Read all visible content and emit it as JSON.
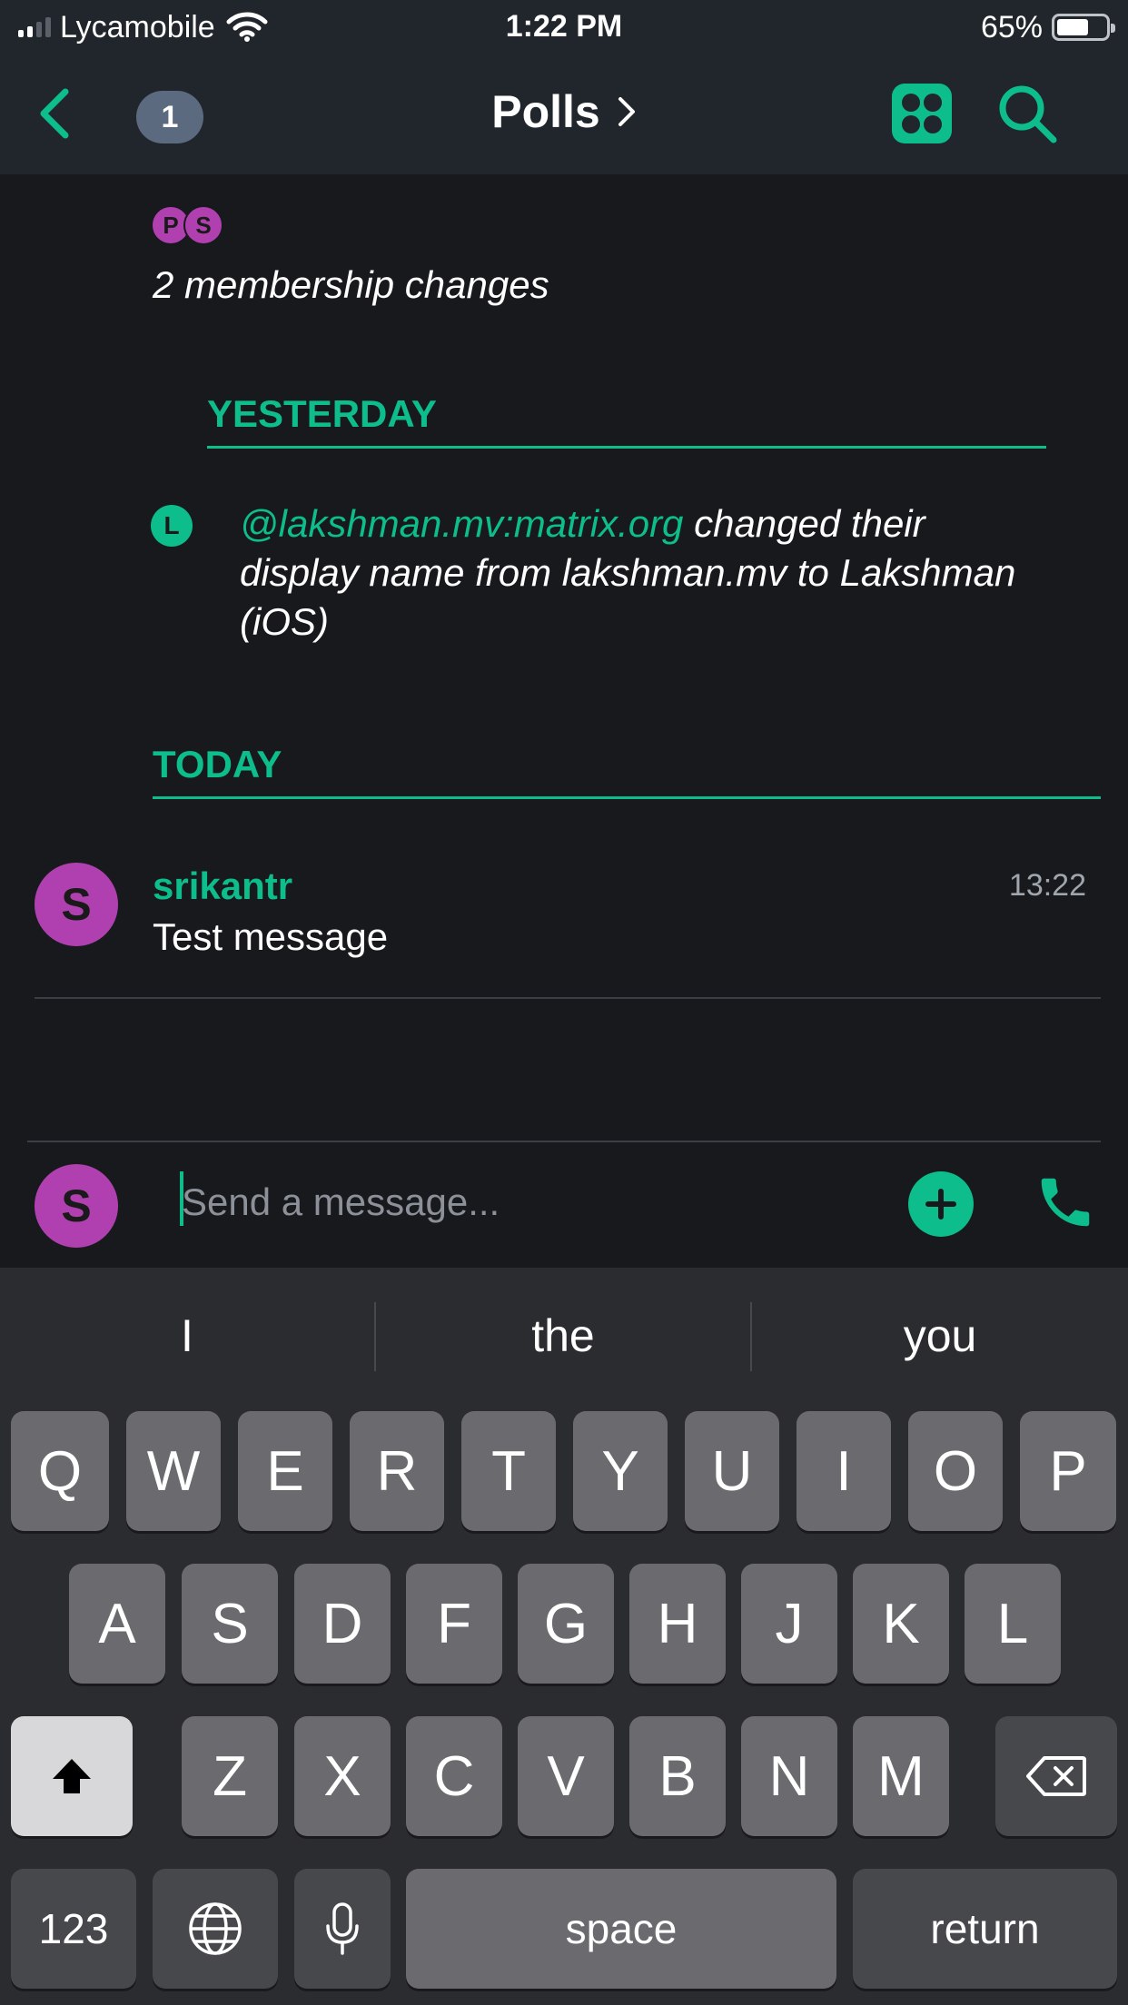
{
  "status_bar": {
    "carrier": "Lycamobile",
    "time": "1:22 PM",
    "battery": "65%",
    "battery_level": 0.65
  },
  "header": {
    "back_icon": "chevron-left-icon",
    "unread_count": "1",
    "title": "Polls",
    "title_chevron": ">",
    "apps_icon": "apps-grid-icon",
    "search_icon": "search-icon"
  },
  "timeline": {
    "membership_avatars": [
      "P",
      "S"
    ],
    "membership_text": "2 membership changes",
    "date_yesterday": "YESTERDAY",
    "event": {
      "avatar": "L",
      "user_id": "@lakshman.mv:matrix.org",
      "text": " changed their display name from lakshman.mv to Lakshman (iOS)"
    },
    "date_today": "TODAY",
    "message": {
      "avatar": "S",
      "sender": "srikantr",
      "time": "13:22",
      "body": "Test message"
    }
  },
  "composer": {
    "avatar": "S",
    "placeholder": "Send a message...",
    "attach_icon": "plus-icon",
    "call_icon": "phone-icon"
  },
  "keyboard": {
    "suggestions": [
      "I",
      "the",
      "you"
    ],
    "row1": [
      "Q",
      "W",
      "E",
      "R",
      "T",
      "Y",
      "U",
      "I",
      "O",
      "P"
    ],
    "row2": [
      "A",
      "S",
      "D",
      "F",
      "G",
      "H",
      "J",
      "K",
      "L"
    ],
    "row3": [
      "Z",
      "X",
      "C",
      "V",
      "B",
      "N",
      "M"
    ],
    "numbers_key": "123",
    "space_key": "space",
    "return_key": "return"
  },
  "colors": {
    "accent": "#0dbd8b",
    "avatar_purple": "#b040b0",
    "background": "#17191c",
    "header": "#21262c"
  }
}
